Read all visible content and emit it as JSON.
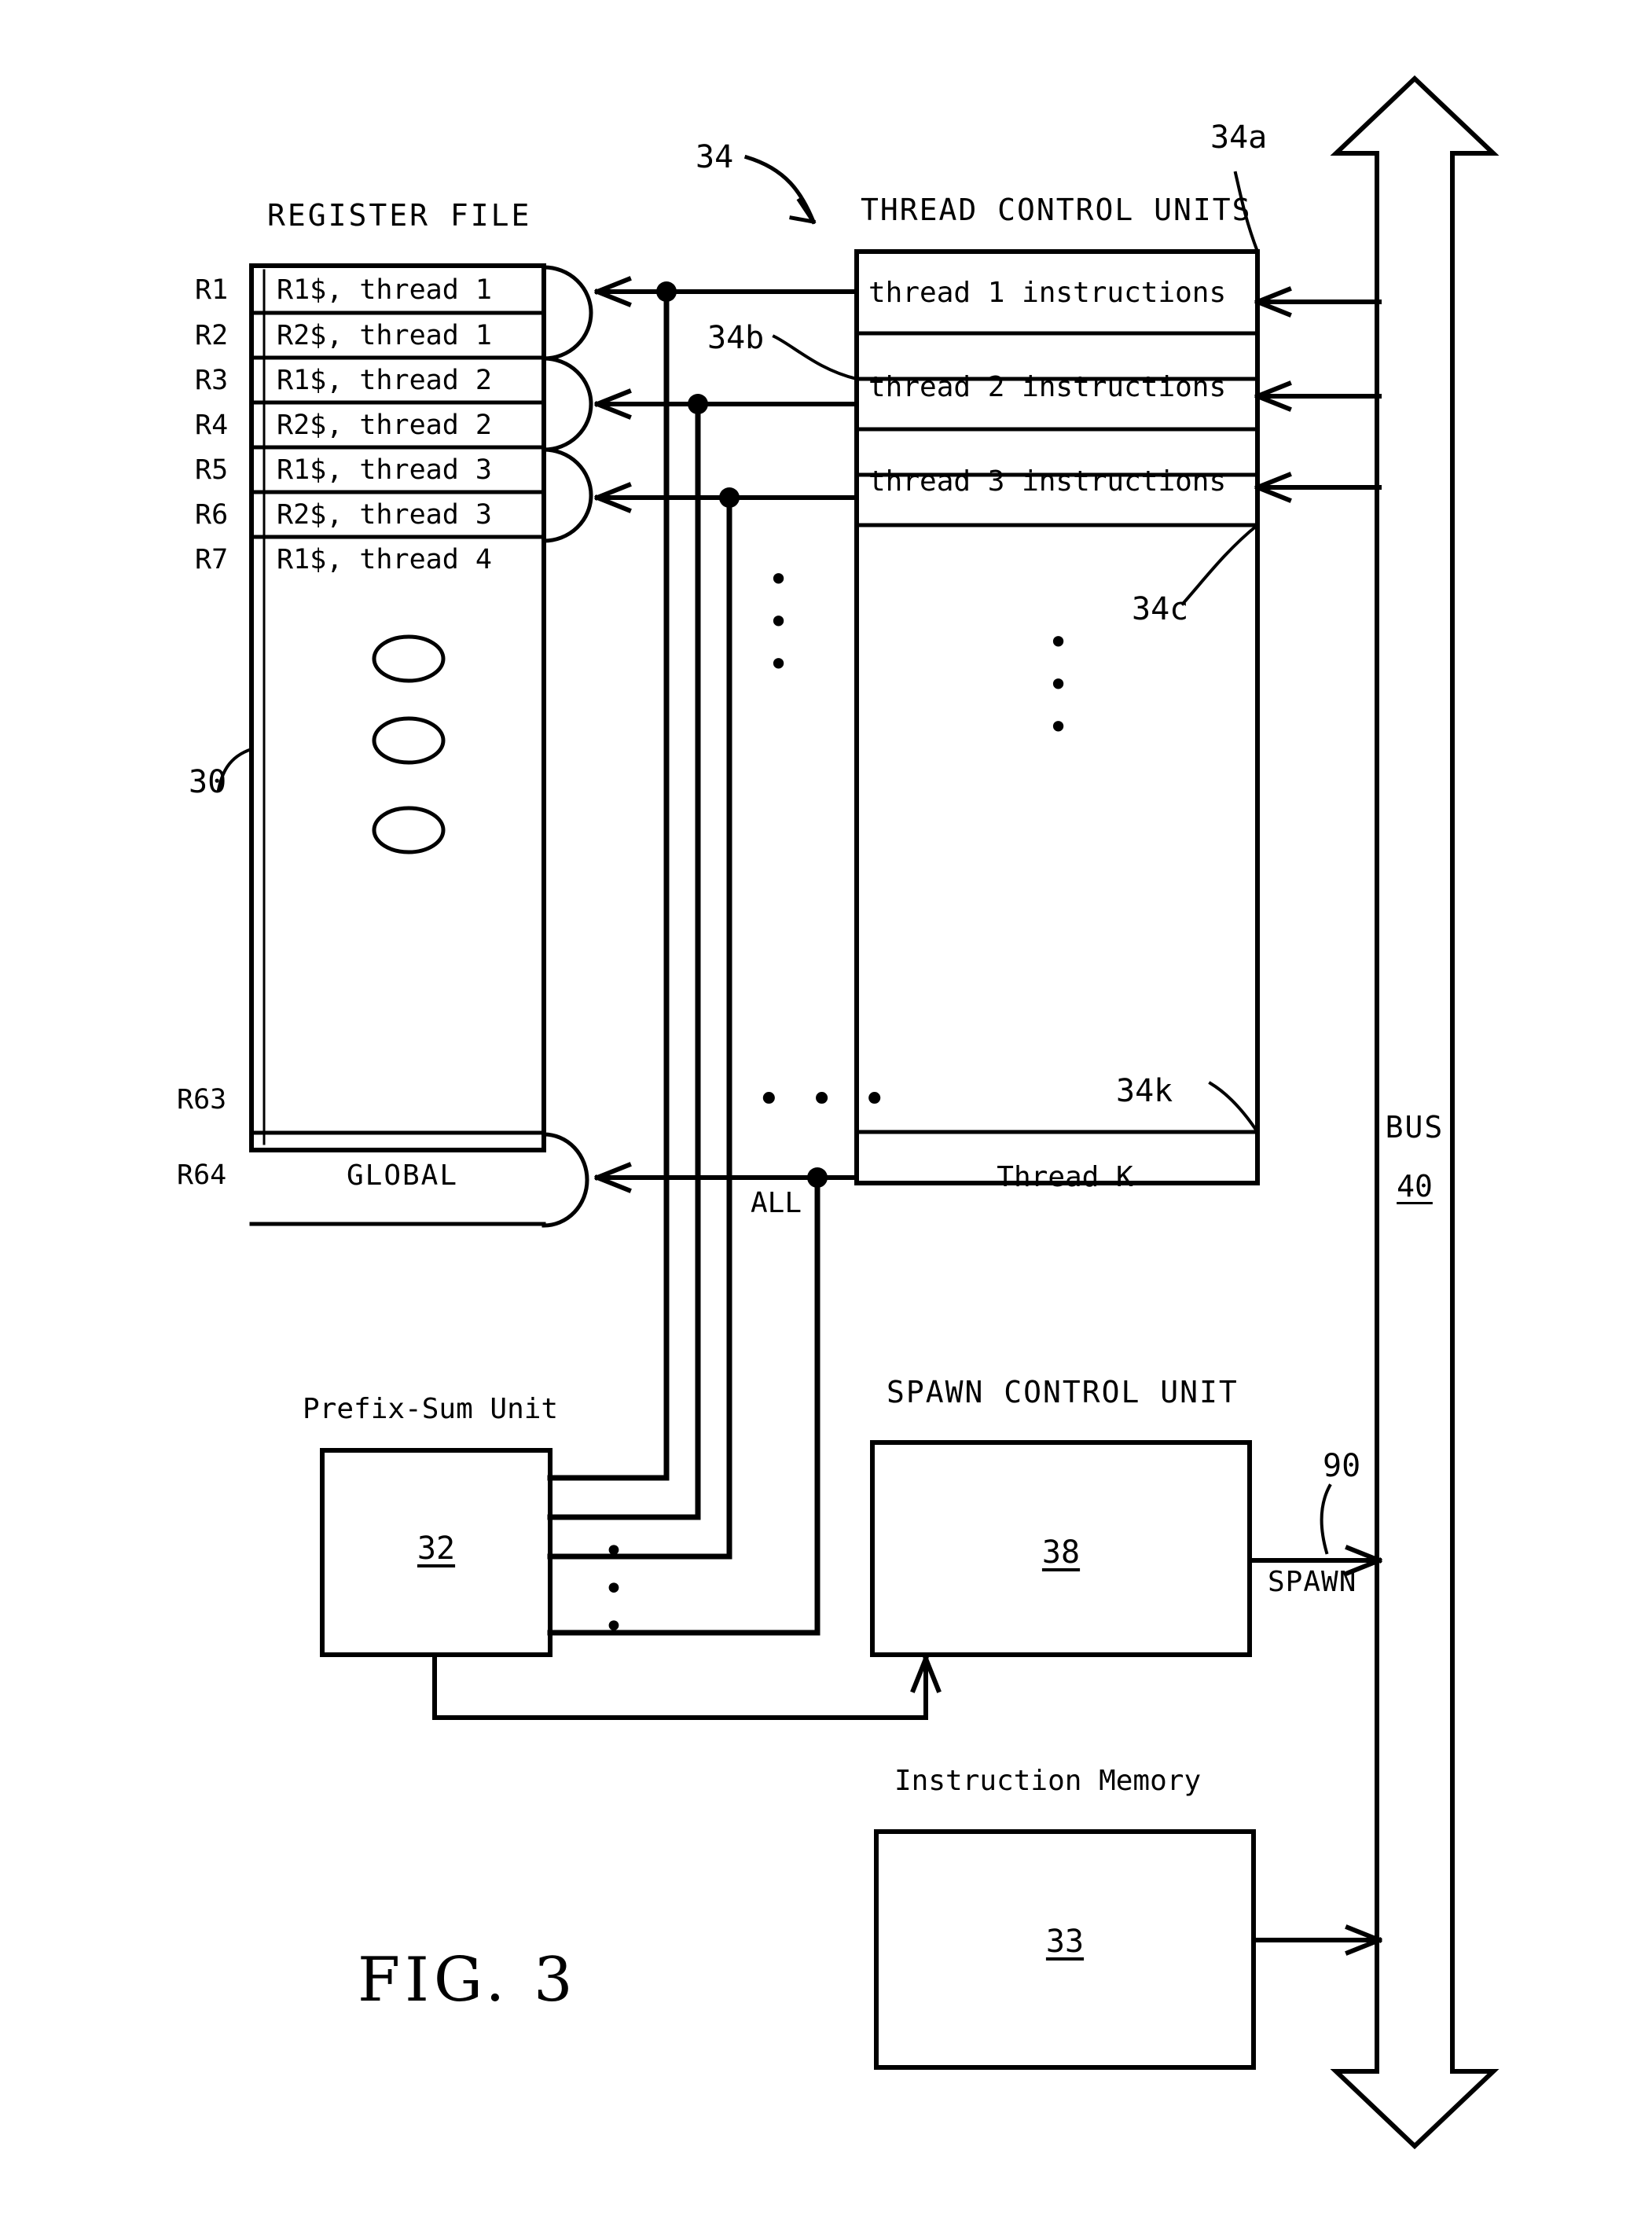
{
  "figure": {
    "caption": "FIG. 3",
    "register_file": {
      "title": "REGISTER FILE",
      "ref": "30",
      "row_labels": [
        "R1",
        "R2",
        "R3",
        "R4",
        "R5",
        "R6",
        "R7"
      ],
      "rows": [
        "R1$, thread 1",
        "R2$, thread 1",
        "R1$, thread 2",
        "R2$, thread 2",
        "R1$, thread 3",
        "R2$, thread 3",
        "R1$, thread 4"
      ],
      "tail_labels": [
        "R63",
        "R64"
      ],
      "global_row": "GLOBAL",
      "vertical_ellipsis": "○ ○ ○"
    },
    "thread_control_units": {
      "title": "THREAD CONTROL UNITS",
      "ref_top": "34",
      "rows": [
        {
          "text": "thread 1 instructions",
          "ref": "34a"
        },
        {
          "text": "thread 2 instructions",
          "ref": "34b"
        },
        {
          "text": "thread 3 instructions",
          "ref": "34c"
        }
      ],
      "last_row": {
        "text": "Thread K",
        "ref": "34k"
      },
      "ellipsis": "• • •"
    },
    "all_bus_label": "ALL",
    "prefix_sum_unit": {
      "title": "Prefix-Sum Unit",
      "ref": "32"
    },
    "spawn_control_unit": {
      "title": "SPAWN CONTROL UNIT",
      "ref": "38",
      "signal_label": "SPAWN",
      "signal_ref": "90"
    },
    "instruction_memory": {
      "title": "Instruction Memory",
      "ref": "33"
    },
    "bus": {
      "title": "BUS",
      "ref": "40"
    },
    "colors": {
      "ink": "#000000",
      "paper": "#ffffff"
    }
  }
}
